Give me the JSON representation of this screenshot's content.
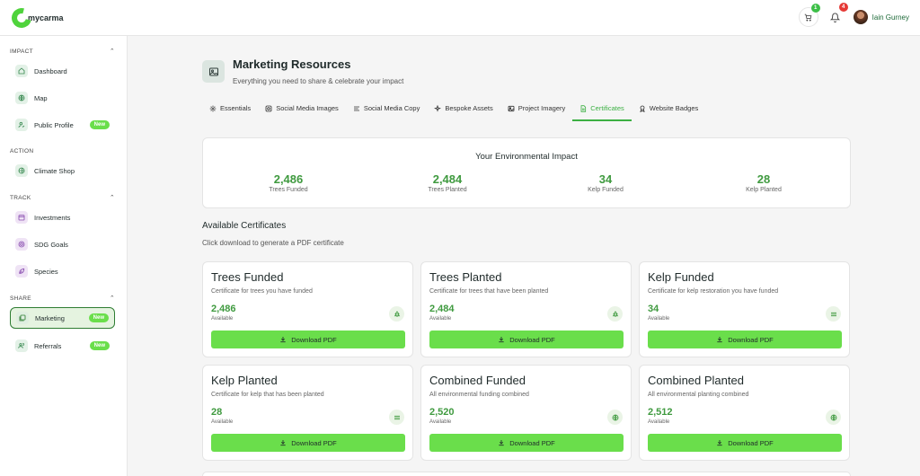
{
  "brand": {
    "name": "mycarma",
    "accent": "#4fd33c"
  },
  "topbar": {
    "cart_badge": "1",
    "notifications_badge": "4",
    "user_name": "Iain Gurney"
  },
  "sidebar": {
    "sections": [
      {
        "title": "IMPACT"
      },
      {
        "title": "ACTION"
      },
      {
        "title": "TRACK"
      },
      {
        "title": "SHARE"
      }
    ],
    "items": [
      {
        "label": "Dashboard",
        "icon": "home-icon"
      },
      {
        "label": "Map",
        "icon": "globe-icon"
      },
      {
        "label": "Public Profile",
        "icon": "user-profile-icon",
        "badge": "New"
      },
      {
        "label": "Climate Shop",
        "icon": "globe-icon"
      },
      {
        "label": "Investments",
        "icon": "calendar-icon"
      },
      {
        "label": "SDG Goals",
        "icon": "target-icon"
      },
      {
        "label": "Species",
        "icon": "leaf-icon"
      },
      {
        "label": "Marketing",
        "icon": "image-stack-icon",
        "badge": "New",
        "active": true
      },
      {
        "label": "Referrals",
        "icon": "users-icon",
        "badge": "New"
      }
    ]
  },
  "header": {
    "title": "Marketing Resources",
    "subtitle": "Everything you need to share & celebrate your impact"
  },
  "tabs": [
    {
      "label": "Essentials"
    },
    {
      "label": "Social Media Images"
    },
    {
      "label": "Social Media Copy"
    },
    {
      "label": "Bespoke Assets"
    },
    {
      "label": "Project Imagery"
    },
    {
      "label": "Certificates",
      "active": true
    },
    {
      "label": "Website Badges"
    }
  ],
  "impact": {
    "title": "Your Environmental Impact",
    "stats": [
      {
        "value": "2,486",
        "label": "Trees Funded"
      },
      {
        "value": "2,484",
        "label": "Trees Planted"
      },
      {
        "value": "34",
        "label": "Kelp Funded"
      },
      {
        "value": "28",
        "label": "Kelp Planted"
      }
    ]
  },
  "certificates": {
    "title": "Available Certificates",
    "subtitle": "Click download to generate a PDF certificate",
    "available_label": "Available",
    "download_label": "Download PDF",
    "items": [
      {
        "title": "Trees Funded",
        "desc": "Certificate for trees you have funded",
        "value": "2,486",
        "icon": "tree-icon"
      },
      {
        "title": "Trees Planted",
        "desc": "Certificate for trees that have been planted",
        "value": "2,484",
        "icon": "tree-icon"
      },
      {
        "title": "Kelp Funded",
        "desc": "Certificate for kelp restoration you have funded",
        "value": "34",
        "icon": "waves-icon"
      },
      {
        "title": "Kelp Planted",
        "desc": "Certificate for kelp that has been planted",
        "value": "28",
        "icon": "waves-icon"
      },
      {
        "title": "Combined Funded",
        "desc": "All environmental funding combined",
        "value": "2,520",
        "icon": "globe-icon"
      },
      {
        "title": "Combined Planted",
        "desc": "All environmental planting combined",
        "value": "2,512",
        "icon": "globe-icon"
      }
    ]
  }
}
